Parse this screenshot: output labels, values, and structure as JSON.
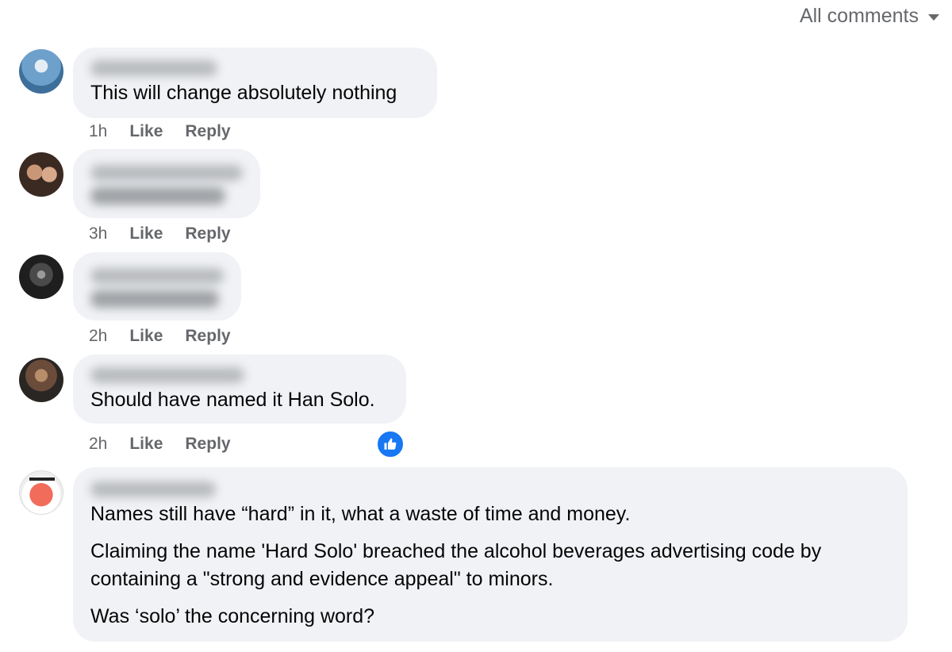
{
  "header": {
    "filter_label": "All comments"
  },
  "comments": [
    {
      "text": "This will change absolutely nothing",
      "time": "1h",
      "like": "Like",
      "reply": "Reply"
    },
    {
      "time": "3h",
      "like": "Like",
      "reply": "Reply"
    },
    {
      "time": "2h",
      "like": "Like",
      "reply": "Reply"
    },
    {
      "text": "Should have named it Han Solo.",
      "time": "2h",
      "like": "Like",
      "reply": "Reply"
    },
    {
      "paragraphs": [
        "Names still have “hard” in it, what a waste of time and money.",
        "Claiming the name 'Hard Solo' breached the alcohol beverages advertising code by containing a \"strong and evidence appeal\" to minors.",
        "Was ‘solo’ the concerning word?"
      ]
    }
  ],
  "colors": {
    "bubble": "#f0f2f5",
    "meta": "#65676b",
    "like_accent": "#1877f2"
  },
  "icons": {
    "filter": "caret-down-icon",
    "reaction": "thumbs-up-icon"
  }
}
